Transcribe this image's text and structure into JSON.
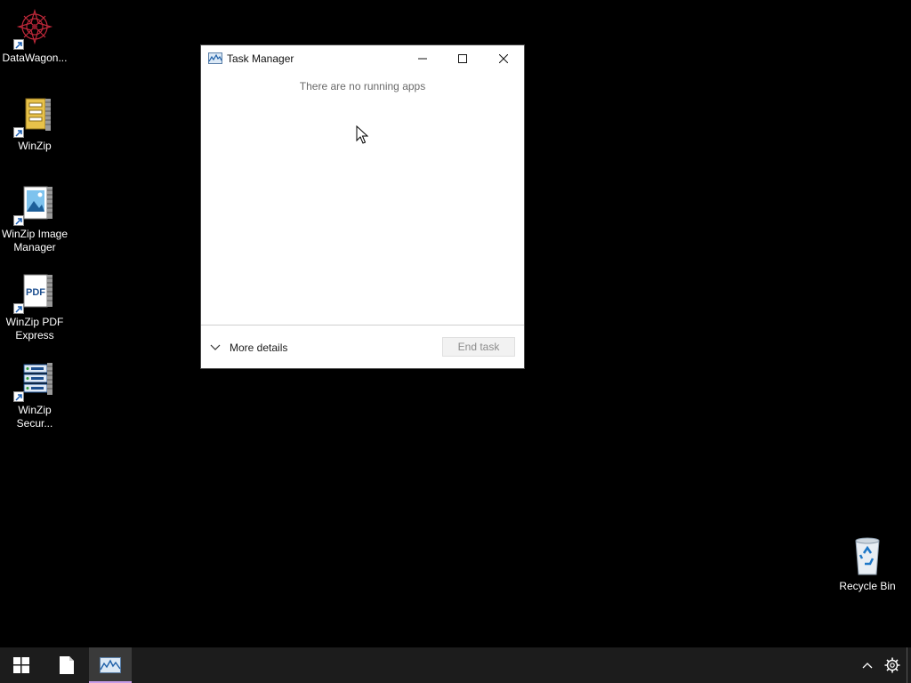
{
  "desktop": {
    "icons": [
      {
        "label": "DataWagon...",
        "icon": "datawagon-icon"
      },
      {
        "label": "WinZip",
        "icon": "winzip-icon"
      },
      {
        "label": "WinZip Image Manager",
        "icon": "winzip-image-manager-icon"
      },
      {
        "label": "WinZip PDF Express",
        "icon": "winzip-pdf-icon"
      },
      {
        "label": "WinZip Secur...",
        "icon": "winzip-secure-icon"
      },
      {
        "label": "Recycle Bin",
        "icon": "recycle-bin-icon"
      }
    ],
    "pdf_glyph": "PDF"
  },
  "task_manager": {
    "title": "Task Manager",
    "empty_message": "There are no running apps",
    "more_details_label": "More details",
    "end_task_label": "End task",
    "end_task_enabled": false
  },
  "taskbar": {
    "items": [
      "start-button",
      "file-explorer",
      "task-manager"
    ],
    "active_item": "task-manager",
    "accent": "#c79be8"
  }
}
